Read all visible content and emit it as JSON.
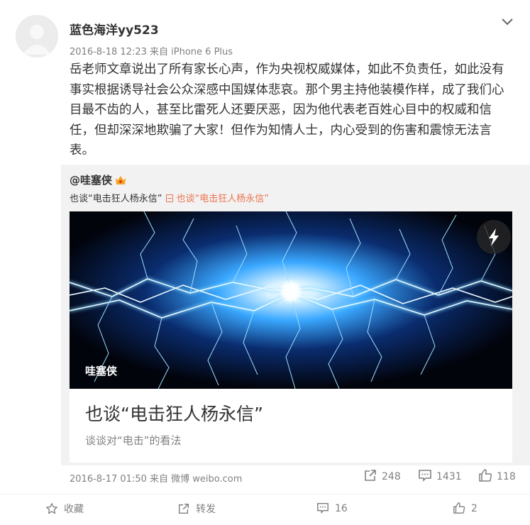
{
  "post": {
    "username": "蓝色海洋yy523",
    "time": "2016-8-18 12:23",
    "source": "来自 iPhone 6 Plus",
    "text": "岳老师文章说出了所有家长心声，作为央视权威媒体，如此不负责任，如此没有事实根据诱导社会公众深感中国媒体悲哀。那个男主持他装模作样，成了我们心目最不齿的人，甚至比雷死人还要厌恶，因为他代表老百姓心目中的权威和信任，但却深深地欺骗了大家！但作为知情人士，内心受到的伤害和震惊无法言表。"
  },
  "repost": {
    "user": "@哇塞侠",
    "user_badge_icon": "vip-crown-icon",
    "text": "也谈“电击狂人杨永信”",
    "link_text": "也谈“电击狂人杨永信”",
    "article": {
      "image_caption": "哇塞侠",
      "title": "也谈“电击狂人杨永信”",
      "description": "谈谈对“电击”的看法"
    },
    "time": "2016-8-17 01:50",
    "source": "来自 微博 weibo.com",
    "stats": {
      "reposts": "248",
      "comments": "1431",
      "likes": "118"
    }
  },
  "actions": {
    "favorite": "收藏",
    "repost": "转发",
    "comment": "16",
    "like": "2"
  },
  "colors": {
    "accent": "#eb7350",
    "text": "#333333",
    "muted": "#808080",
    "repost_bg": "#f2f2f2"
  }
}
